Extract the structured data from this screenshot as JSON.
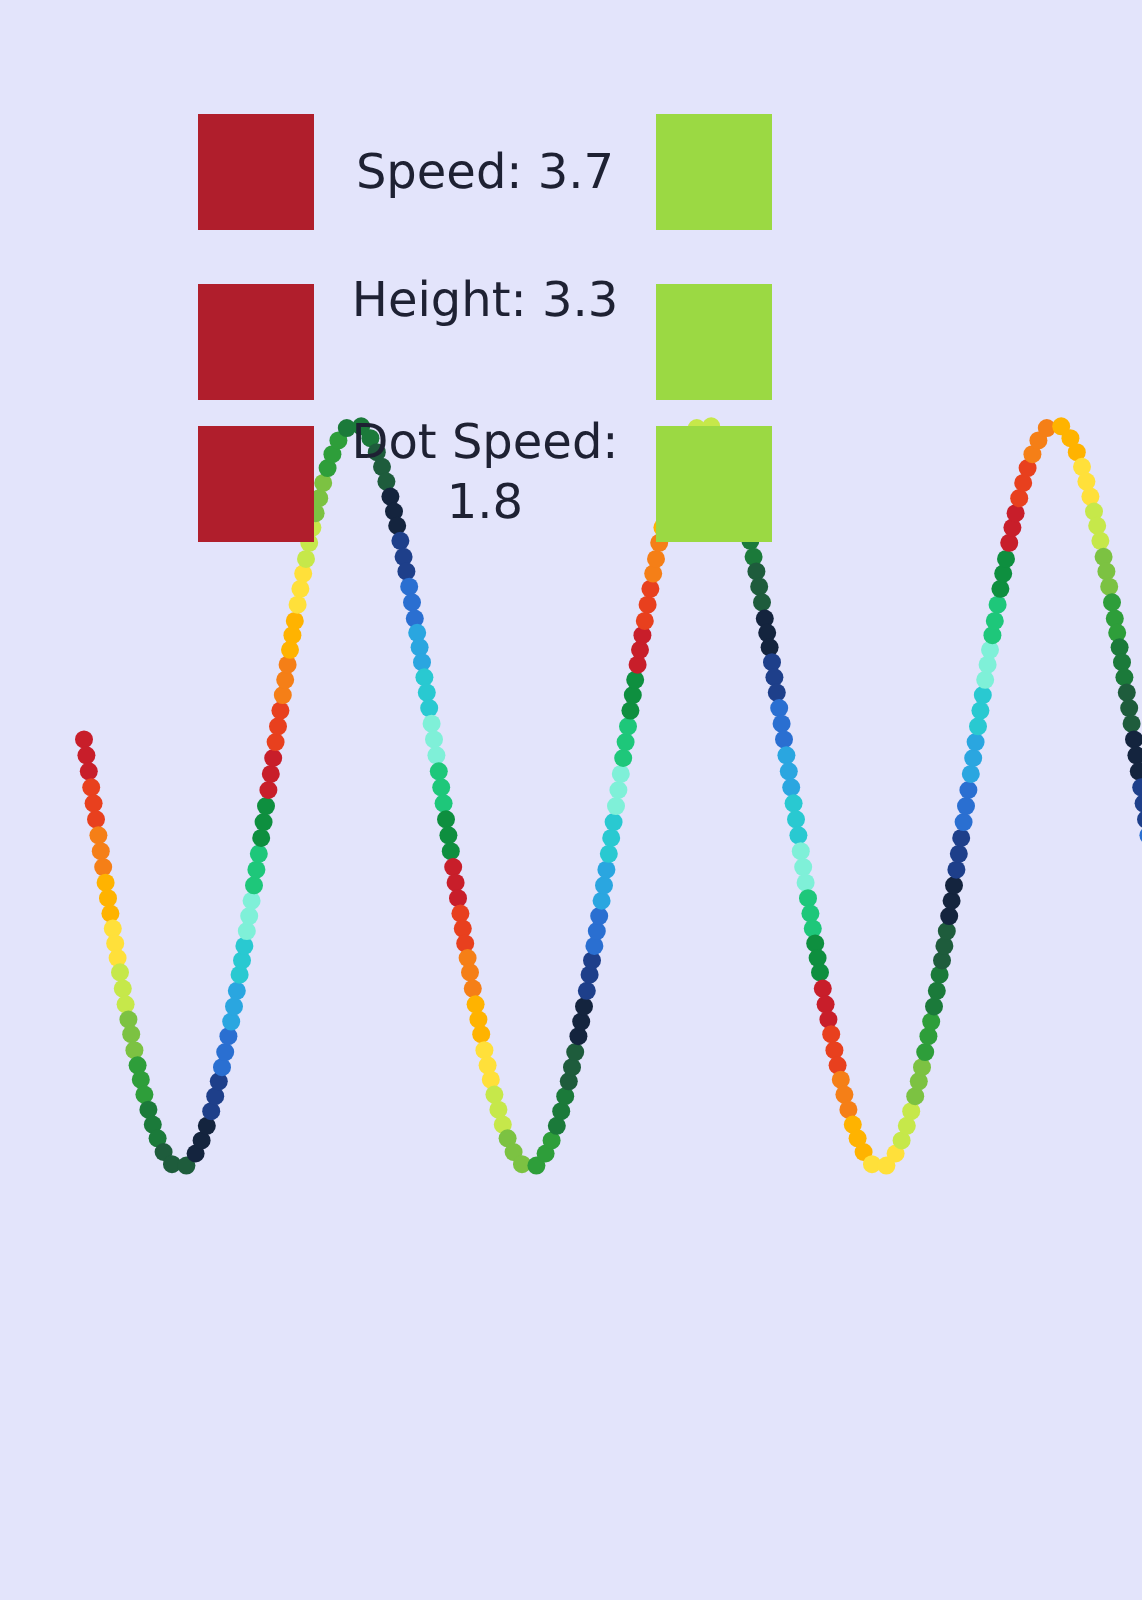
{
  "controls": [
    {
      "label": "Speed: 3.7"
    },
    {
      "label": "Height: 3.3"
    },
    {
      "label": "Dot Speed: 1.8"
    }
  ]
}
